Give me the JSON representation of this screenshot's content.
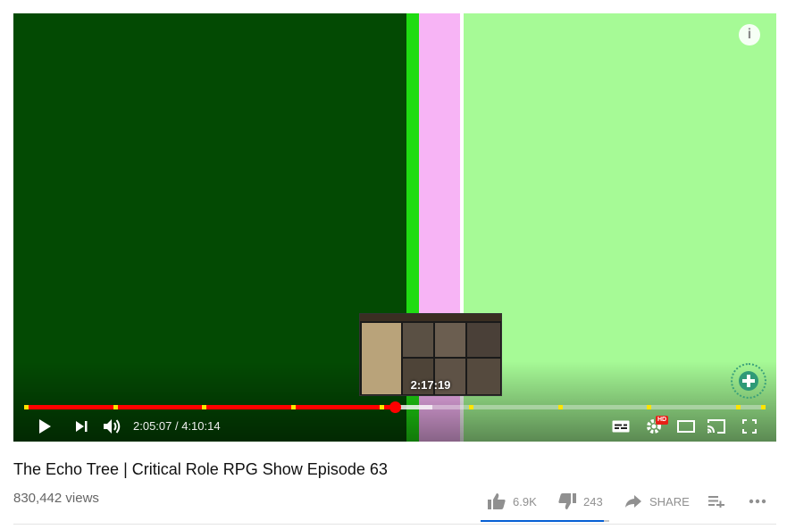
{
  "player": {
    "current_time": "2:05:07",
    "separator": " / ",
    "duration": "4:10:14",
    "played_fraction": 0.5,
    "buffered_fraction": 0.55,
    "chapter_marker_fractions": [
      0.0,
      0.12,
      0.24,
      0.36,
      0.48,
      0.6,
      0.72,
      0.84,
      0.96,
      1.0
    ],
    "preview_time": "2:17:19",
    "info_glyph": "i",
    "hd_badge": "HD"
  },
  "video": {
    "title": "The Echo Tree | Critical Role RPG Show Episode 63",
    "views": "830,442 views"
  },
  "actions": {
    "likes": "6.9K",
    "dislikes": "243",
    "share_label": "SHARE",
    "like_fraction": 0.96
  },
  "colors": {
    "progress_played": "#ff0000",
    "chapter_marker": "#ffe400",
    "sentiment_bar": "#065fd4",
    "video_dark_green": "#034a03",
    "video_light_green": "#a6fa96",
    "video_pink": "#f7b4f5"
  },
  "icons": [
    "info-icon",
    "play-icon",
    "next-icon",
    "volume-icon",
    "subtitles-icon",
    "settings-icon",
    "miniplayer-icon",
    "cast-icon",
    "fullscreen-icon",
    "thumb-up-icon",
    "thumb-down-icon",
    "share-icon",
    "add-to-playlist-icon",
    "more-icon",
    "channel-watermark-icon"
  ]
}
